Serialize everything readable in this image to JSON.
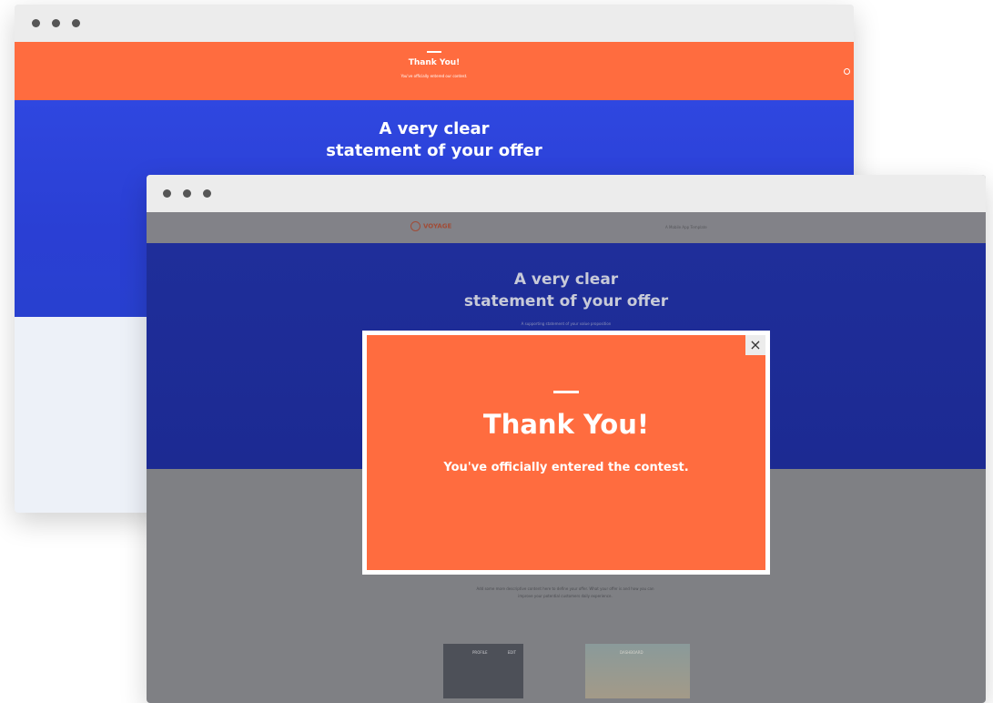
{
  "back_window": {
    "banner": {
      "title": "Thank You!",
      "subtitle": "You've officially entered our contest."
    },
    "hero": {
      "title_line1": "A very clear",
      "title_line2": "statement of your offer"
    }
  },
  "front_window": {
    "nav": {
      "logo_text": "VOYAGE",
      "tagline": "A Mobile App Template"
    },
    "hero": {
      "title_line1": "A very clear",
      "title_line2": "statement of your offer",
      "subtitle": "A supporting statement of your value proposition"
    },
    "body": {
      "description": "Add some more descriptive content here to define your offer. What your offer is and how you can improve your potential customers daily experience.",
      "cards": [
        {
          "label": "PROFILE",
          "label2": "EDIT"
        },
        {
          "label": "DASHBOARD"
        }
      ]
    }
  },
  "modal": {
    "close_glyph": "×",
    "title": "Thank You!",
    "message": "You've officially entered the contest."
  },
  "colors": {
    "accent": "#ff6c3f",
    "hero_blue": "#2f47e0",
    "window_bar": "#ececec"
  }
}
